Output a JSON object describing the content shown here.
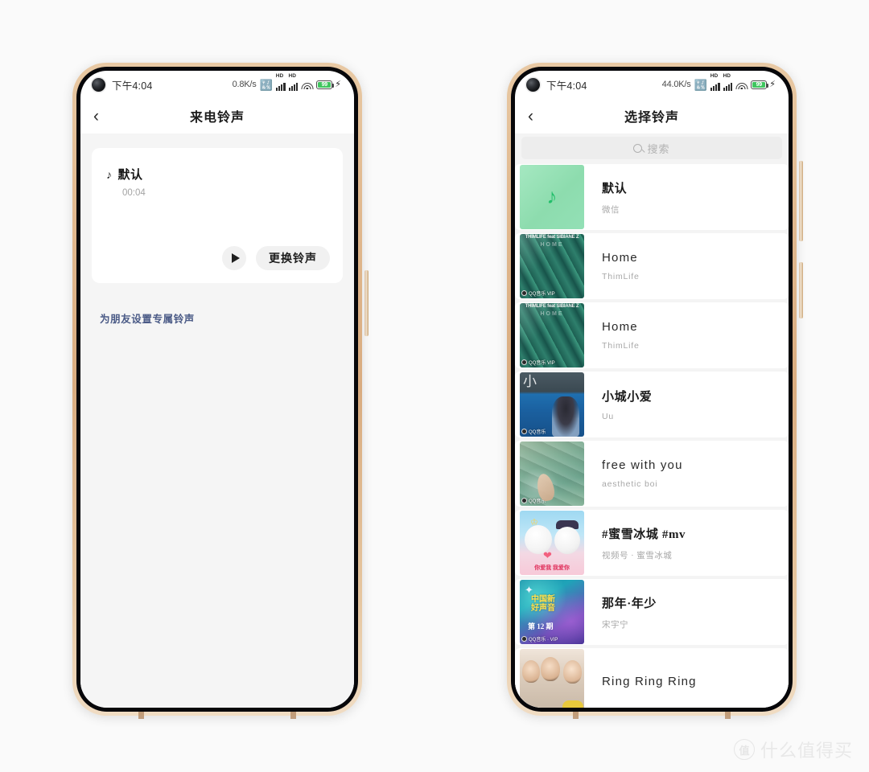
{
  "left_phone": {
    "status_bar": {
      "time": "下午4:04",
      "net_speed": "0.8K/s",
      "bluetooth_icon": "bluetooth-icon",
      "signal_label_1": "HD",
      "signal_label_2": "HD",
      "wifi_icon": "wifi-icon",
      "battery_level": "99",
      "charging_icon": "lightning-bolt-icon"
    },
    "nav": {
      "back_icon": "chevron-left-icon",
      "title": "来电铃声"
    },
    "card": {
      "note_icon": "music-note-icon",
      "title": "默认",
      "duration": "00:04",
      "play_icon": "play-icon",
      "change_button": "更换铃声"
    },
    "friend_link": "为朋友设置专属铃声"
  },
  "right_phone": {
    "status_bar": {
      "time": "下午4:04",
      "net_speed": "44.0K/s",
      "bluetooth_icon": "bluetooth-icon",
      "signal_label_1": "HD",
      "signal_label_2": "HD",
      "wifi_icon": "wifi-icon",
      "battery_level": "99",
      "charging_icon": "lightning-bolt-icon"
    },
    "nav": {
      "back_icon": "chevron-left-icon",
      "title": "选择铃声"
    },
    "search": {
      "icon": "search-icon",
      "placeholder": "搜索"
    },
    "ringtones": [
      {
        "title": "默认",
        "subtitle": "微信",
        "art": "green-note",
        "badge": ""
      },
      {
        "title": "Home",
        "subtitle": "ThimLife",
        "art": "home",
        "badge": "QQ音乐 VIP"
      },
      {
        "title": "Home",
        "subtitle": "ThimLife",
        "art": "home",
        "badge": "QQ音乐 VIP"
      },
      {
        "title": "小城小爱",
        "subtitle": "Uu",
        "art": "city",
        "badge": "QQ音乐"
      },
      {
        "title": "free with you",
        "subtitle": "aesthetic boi",
        "art": "free",
        "badge": "QQ音乐"
      },
      {
        "title": "#蜜雪冰城 #mv",
        "subtitle": "视频号 · 蜜雪冰城",
        "art": "mxbc",
        "badge": ""
      },
      {
        "title": "那年·年少",
        "subtitle": "宋宇宁",
        "art": "voice",
        "badge": "QQ音乐 · VIP"
      },
      {
        "title": "Ring Ring Ring",
        "subtitle": "",
        "art": "ring",
        "badge": ""
      }
    ]
  },
  "art_text": {
    "home_header": "THIMLIFE feat SIBIANE Z",
    "home_sub": "HOME",
    "mxbc_caption": "你爱我 我爱你",
    "voice_line1": "中国新",
    "voice_line1b": "好声音",
    "voice_line2": "第 12 期"
  },
  "watermark": {
    "logo": "值",
    "text": "什么值得买"
  },
  "colors": {
    "frame_gold": "#e2bb92",
    "accent_green": "#23bf6b",
    "link_blue": "#4a5a86",
    "battery_green": "#3fc55e"
  }
}
